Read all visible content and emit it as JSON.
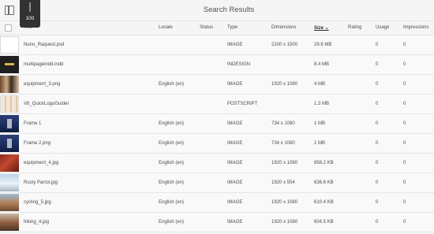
{
  "header": {
    "title": "Search Results",
    "slider_value": "100"
  },
  "columns": {
    "title": "Title",
    "locale": "Locale",
    "status": "Status",
    "type": "Type",
    "dimensions": "Dimensions",
    "size": "Size",
    "rating": "Rating",
    "usage": "Usage",
    "impressions": "Impressions"
  },
  "rows": [
    {
      "title": "Nuno_Raquest.psd",
      "locale": "",
      "status": "",
      "type": "IMAGE",
      "dimensions": "2100 x 1500",
      "size": "29.6 MB",
      "rating": "",
      "usage": "0",
      "impressions": "0",
      "thumb": "document-light-thumbnail"
    },
    {
      "title": "multipageindd.indd",
      "locale": "",
      "status": "",
      "type": "INDESIGN",
      "dimensions": "",
      "size": "8.4 MB",
      "rating": "",
      "usage": "0",
      "impressions": "0",
      "thumb": "dark-book-thumbnail"
    },
    {
      "title": "equipment_3.png",
      "locale": "English (en)",
      "status": "",
      "type": "IMAGE",
      "dimensions": "1920 x 1080",
      "size": "4 MB",
      "rating": "",
      "usage": "0",
      "impressions": "0",
      "thumb": "equipment-photo-thumbnail"
    },
    {
      "title": "V8_QuickLogoGuideI",
      "locale": "",
      "status": "",
      "type": "POSTSCRIPT",
      "dimensions": "",
      "size": "1.3 MB",
      "rating": "",
      "usage": "0",
      "impressions": "0",
      "thumb": "logo-guide-thumbnail"
    },
    {
      "title": "Frame 1",
      "locale": "English (en)",
      "status": "",
      "type": "IMAGE",
      "dimensions": "734 x 1080",
      "size": "1 MB",
      "rating": "",
      "usage": "0",
      "impressions": "0",
      "thumb": "blue-frame-thumbnail"
    },
    {
      "title": "Frame 2.png",
      "locale": "English (en)",
      "status": "",
      "type": "IMAGE",
      "dimensions": "734 x 1080",
      "size": "1 MB",
      "rating": "",
      "usage": "0",
      "impressions": "0",
      "thumb": "blue-frame-thumbnail"
    },
    {
      "title": "equipment_4.jpg",
      "locale": "English (en)",
      "status": "",
      "type": "IMAGE",
      "dimensions": "1920 x 1080",
      "size": "658.2 KB",
      "rating": "",
      "usage": "0",
      "impressions": "0",
      "thumb": "red-equipment-thumbnail"
    },
    {
      "title": "Rusty Parrot.jpg",
      "locale": "English (en)",
      "status": "",
      "type": "IMAGE",
      "dimensions": "1920 x 554",
      "size": "636.6 KB",
      "rating": "",
      "usage": "0",
      "impressions": "0",
      "thumb": "snowy-lodge-thumbnail"
    },
    {
      "title": "cycling_5.jpg",
      "locale": "English (en)",
      "status": "",
      "type": "IMAGE",
      "dimensions": "1920 x 1080",
      "size": "610.4 KB",
      "rating": "",
      "usage": "0",
      "impressions": "0",
      "thumb": "cycling-landscape-thumbnail"
    },
    {
      "title": "hiking_4.jpg",
      "locale": "English (en)",
      "status": "",
      "type": "IMAGE",
      "dimensions": "1920 x 1080",
      "size": "604.5 KB",
      "rating": "",
      "usage": "0",
      "impressions": "0",
      "thumb": "hiking-landscape-thumbnail"
    }
  ]
}
